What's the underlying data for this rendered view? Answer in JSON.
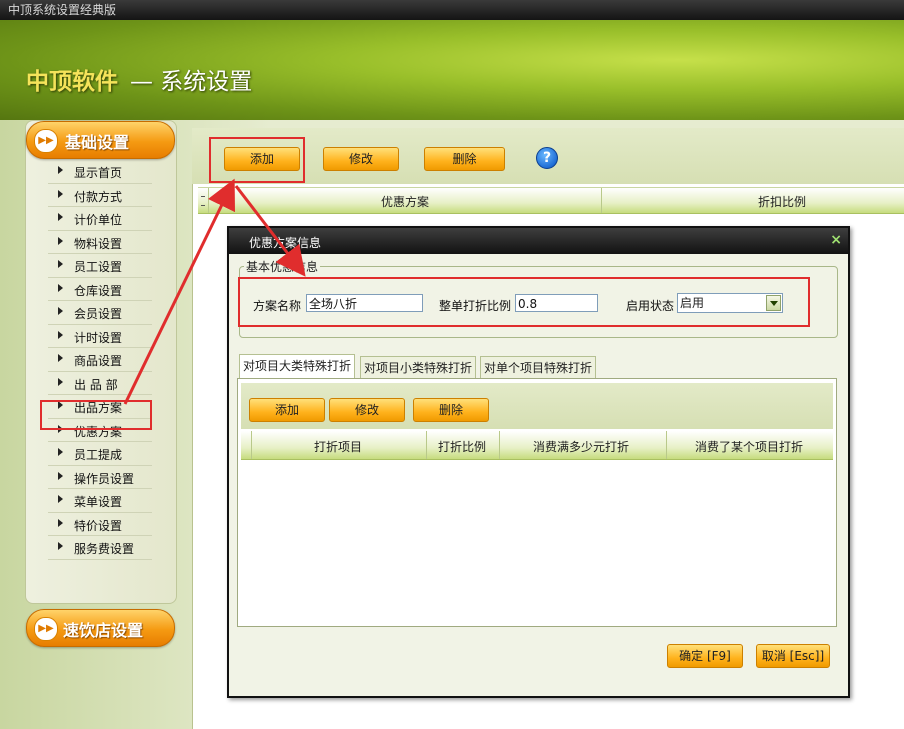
{
  "window": {
    "title": "中顶系统设置经典版"
  },
  "banner": {
    "brand": "中顶软件",
    "subtitle": "— 系统设置"
  },
  "sidebar": {
    "section_basic": "基础设置",
    "section_fastfood": "速饮店设置",
    "items": [
      "显示首页",
      "付款方式",
      "计价单位",
      "物料设置",
      "员工设置",
      "仓库设置",
      "会员设置",
      "计时设置",
      "商品设置",
      "出 品 部",
      "出品方案",
      "优惠方案",
      "员工提成",
      "操作员设置",
      "菜单设置",
      "特价设置",
      "服务费设置"
    ],
    "selected": "优惠方案"
  },
  "toolbar": {
    "add": "添加",
    "edit": "修改",
    "delete": "删除",
    "help": "?"
  },
  "grid": {
    "columns": [
      "优惠方案",
      "折扣比例"
    ]
  },
  "dialog": {
    "title": "优惠方案信息",
    "close": "×",
    "group_label": "基本优惠信息",
    "name_label": "方案名称",
    "name_value": "全场八折",
    "ratio_label": "整单打折比例",
    "ratio_value": "0.8",
    "status_label": "启用状态",
    "status_value": "启用",
    "tabs": [
      "对项目大类特殊打折",
      "对项目小类特殊打折",
      "对单个项目特殊打折"
    ],
    "tab_toolbar": {
      "add": "添加",
      "edit": "修改",
      "delete": "删除"
    },
    "sub_columns": [
      "打折项目",
      "打折比例",
      "消费满多少元打折",
      "消费了某个项目打折"
    ],
    "ok": "确定 [F9]",
    "cancel": "取消 [Esc]]"
  },
  "colors": {
    "accent_orange": "#f59a12",
    "highlight_red": "#e02d2d",
    "banner_green": "#99bf2a"
  },
  "icons": [
    "double-arrow-icon",
    "help-icon",
    "close-icon",
    "dropdown-arrow-icon",
    "bullet-arrow-icon"
  ]
}
